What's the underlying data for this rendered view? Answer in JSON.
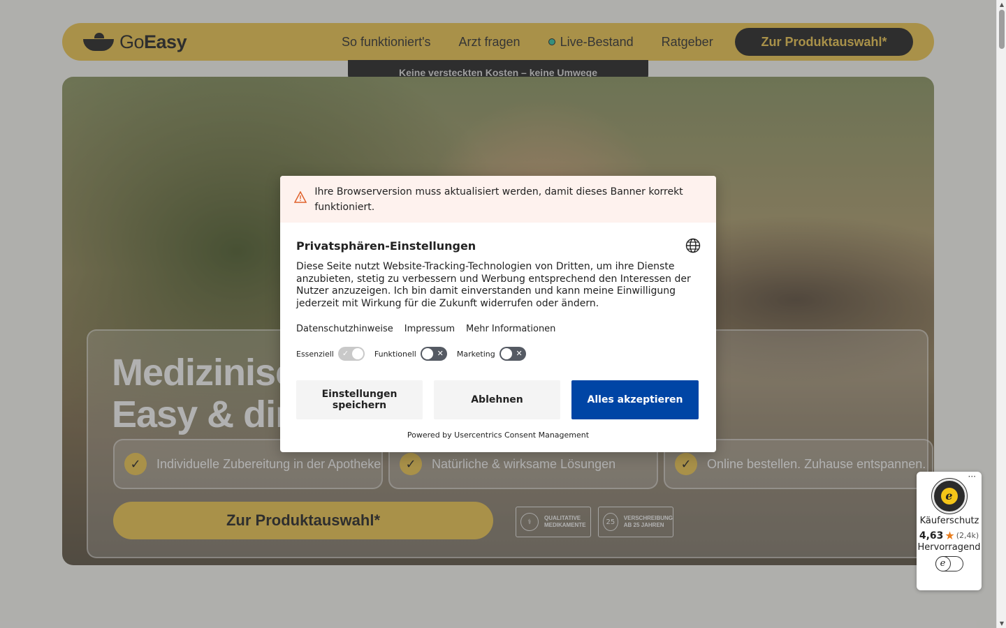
{
  "brand": {
    "logo_go": "Go",
    "logo_easy": "Easy"
  },
  "nav": {
    "items": [
      {
        "label": "So funktioniert's"
      },
      {
        "label": "Arzt fragen"
      },
      {
        "label": "Live-Bestand"
      },
      {
        "label": "Ratgeber"
      }
    ],
    "cta_label": "Zur Produktauswahl*"
  },
  "tagline": "Keine versteckten Kosten – keine Umwege",
  "hero": {
    "title_line1": "Medizinisch",
    "title_line2": "Easy & dir",
    "features": [
      {
        "text": "Individuelle Zubereitung in der Apotheke"
      },
      {
        "text": "Natürliche & wirksame Lösungen"
      },
      {
        "text": "Online bestellen. Zuhause entspannen."
      }
    ],
    "cta_label": "Zur Produktauswahl*",
    "badges": [
      {
        "line1": "QUALITATIVE",
        "line2": "MEDIKAMENTE",
        "icon": "caduceus-icon"
      },
      {
        "line1": "VERSCHREIBUNG",
        "line2": "AB 25 JAHREN",
        "icon": "25-plus-icon"
      }
    ]
  },
  "consent": {
    "warning": "Ihre Browserversion muss aktualisiert werden, damit dieses Banner korrekt funktioniert.",
    "title": "Privatsphären-Einstellungen",
    "description": "Diese Seite nutzt Website-Tracking-Technologien von Dritten, um ihre Dienste anzubieten, stetig zu verbessern und Werbung entsprechend den Interessen der Nutzer anzuzeigen. Ich bin damit einverstanden und kann meine Einwilligung jederzeit mit Wirkung für die Zukunft widerrufen oder ändern.",
    "links": [
      "Datenschutzhinweise",
      "Impressum",
      "Mehr Informationen"
    ],
    "toggles": [
      {
        "label": "Essenziell",
        "state": "on-disabled"
      },
      {
        "label": "Funktionell",
        "state": "off"
      },
      {
        "label": "Marketing",
        "state": "off"
      }
    ],
    "buttons": {
      "save": "Einstellungen speichern",
      "deny": "Ablehnen",
      "accept": "Alles akzeptieren"
    },
    "powered_by": "Powered by Usercentrics Consent Management"
  },
  "trusted_shops": {
    "more": "···",
    "label": "Käuferschutz",
    "score": "4,63",
    "count": "(2,4k)",
    "grade": "Hervorragend"
  },
  "colors": {
    "brand_yellow": "#f2c94c",
    "dark": "#1e1e1e",
    "accept_blue": "#0045a5",
    "warning_bg": "#fef2ee",
    "warning_icon": "#e0622c",
    "star": "#e97c1b"
  }
}
